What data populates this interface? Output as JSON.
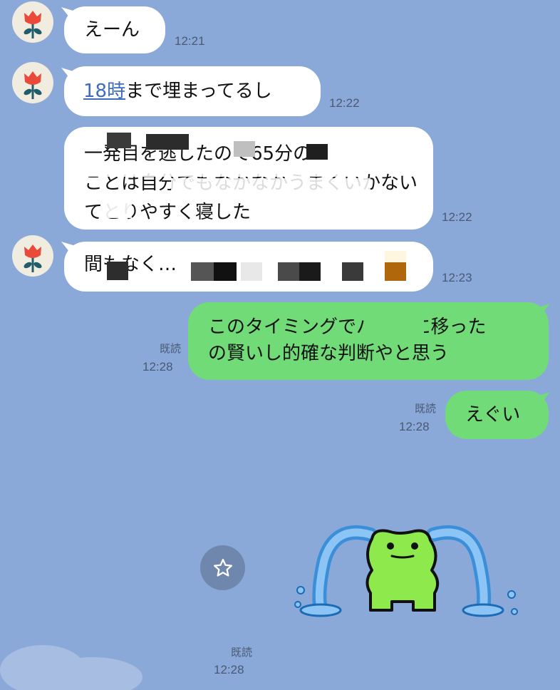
{
  "messages": [
    {
      "text": "えーん",
      "time": "12:21"
    },
    {
      "link_text": "18時",
      "rest_text": "まで埋まってるし",
      "time": "12:22"
    },
    {
      "lines": [
        "一発目を逃したので65分の",
        "ことは自分でもなかなかうまくいかない",
        "てとりやすく寝した"
      ],
      "time": "12:22"
    },
    {
      "lines": [
        "間もなく…"
      ],
      "time": "12:23"
    },
    {
      "lines": [
        "このタイミングでバンプに移った",
        "の賢いし的確な判断やと思う"
      ],
      "read": "既読",
      "time": "12:28"
    },
    {
      "text": "えぐい",
      "read": "既読",
      "time": "12:28"
    },
    {
      "read": "既読",
      "time": "12:28"
    }
  ],
  "icons": {
    "avatar": "flower-icon",
    "star": "star-icon",
    "sticker": "crying-frog-sticker"
  },
  "colors": {
    "background": "#8aa8d8",
    "incoming": "#ffffff",
    "outgoing": "#71dc77",
    "link": "#3d6cc0"
  }
}
